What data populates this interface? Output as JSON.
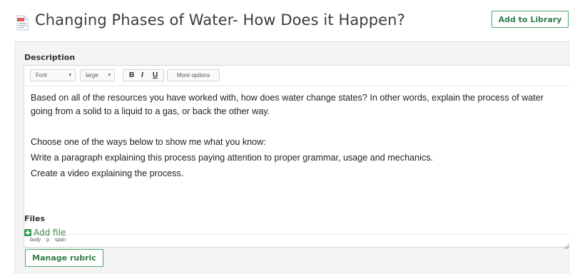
{
  "header": {
    "title": "Changing Phases of Water- How Does it Happen?",
    "add_to_library": "Add to Library"
  },
  "description": {
    "label": "Description",
    "toolbar": {
      "font_select": "Font",
      "size_select": "large",
      "bold": "B",
      "italic": "I",
      "underline": "U",
      "more_options": "More options"
    },
    "paragraphs": [
      "Based on all of the resources you have worked with, how does water change states? In other words, explain the process of water going from a solid to a liquid to a gas, or back the other way.",
      "",
      "Choose one of the ways below to show me what you know:",
      "Write a paragraph explaining this process paying attention to proper grammar, usage and mechanics.",
      "Create a video explaining the process."
    ],
    "status_path": [
      "body",
      "p",
      "span"
    ]
  },
  "files": {
    "label": "Files",
    "add_file": "Add file"
  },
  "manage_rubric": "Manage rubric",
  "colors": {
    "accent_green": "#4aa564",
    "panel_bg": "#f4f4f4",
    "doc_icon_red": "#e25c5c"
  }
}
